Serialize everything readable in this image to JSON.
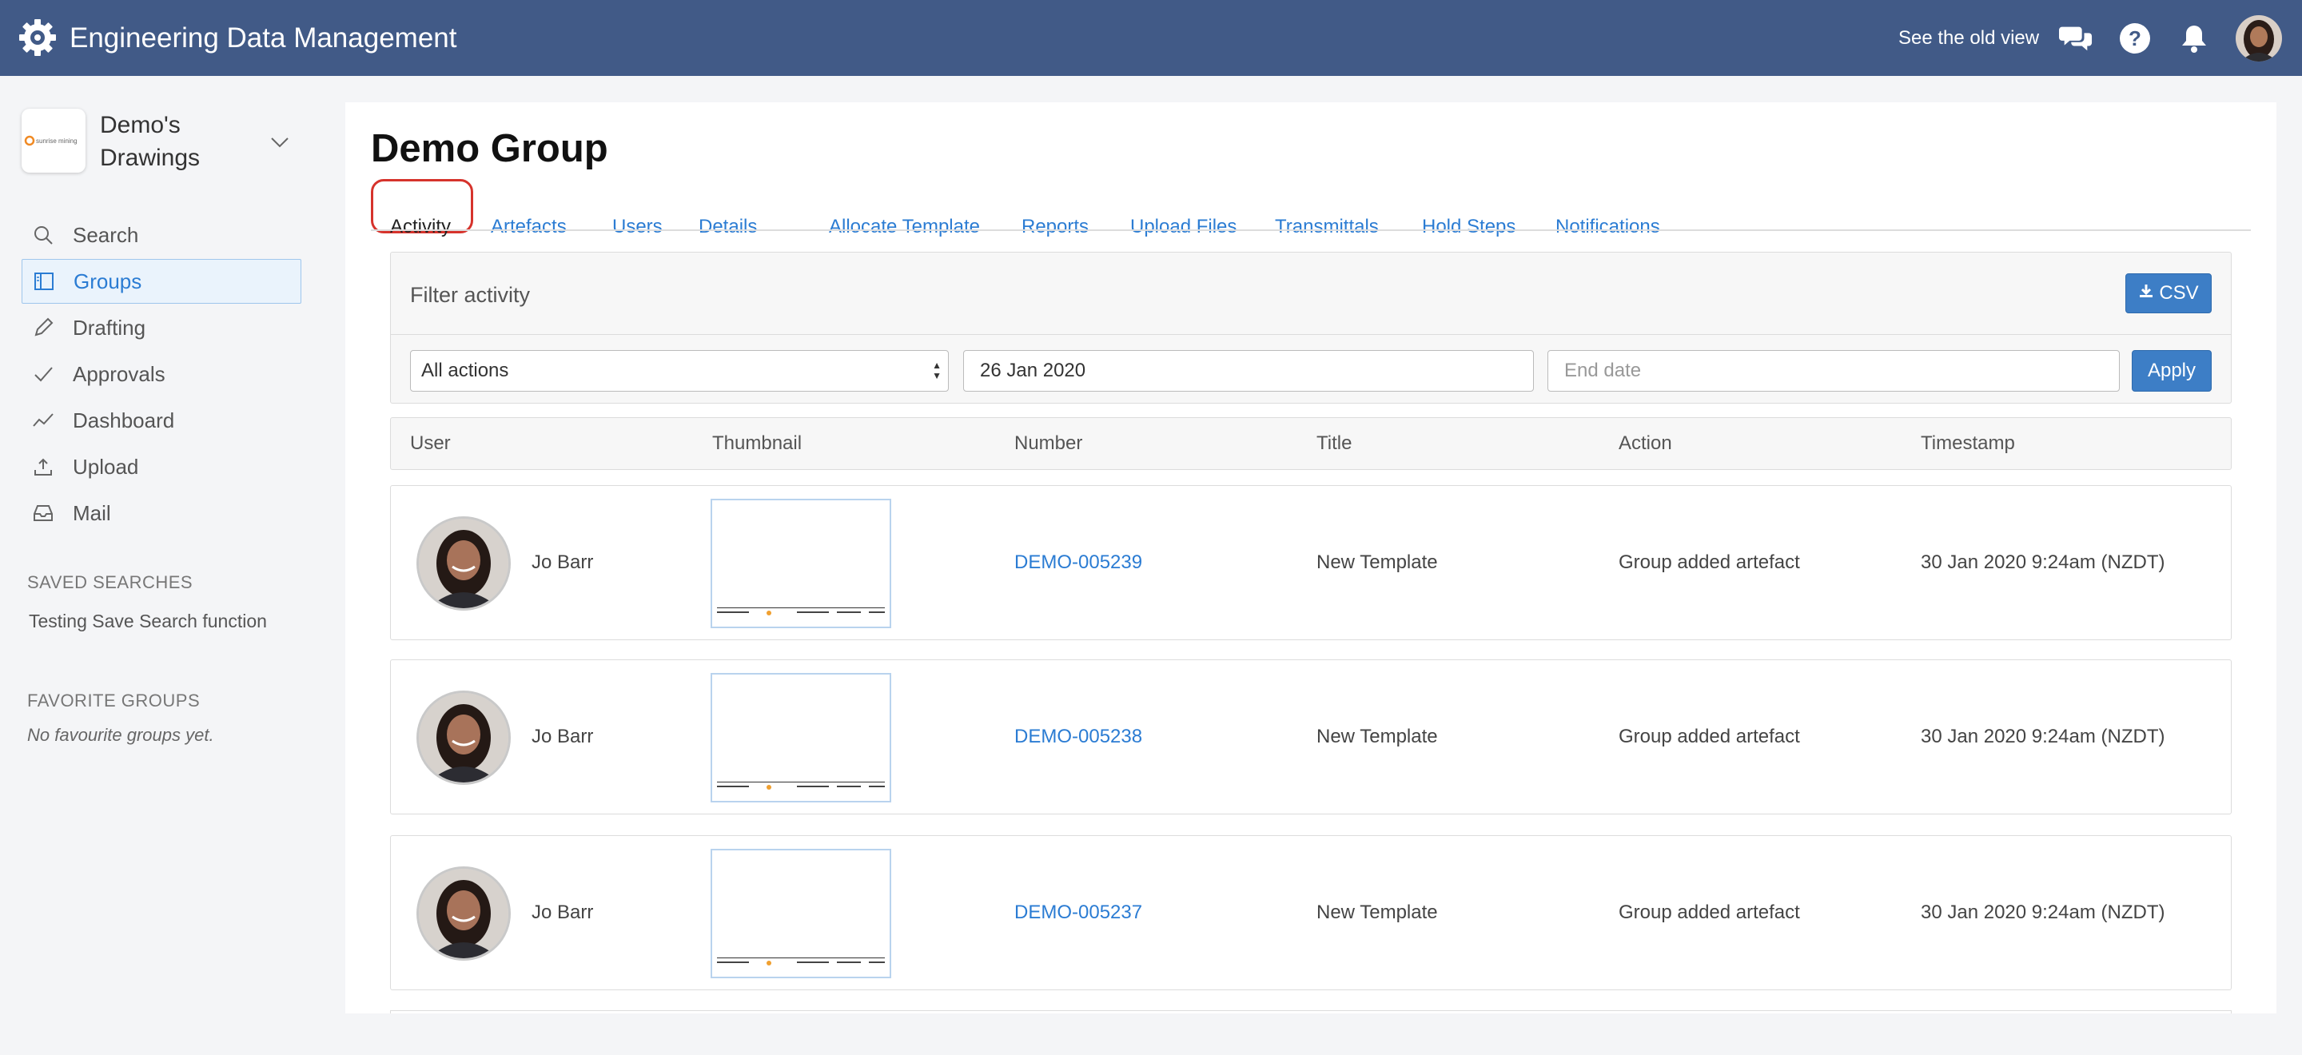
{
  "header": {
    "app_title": "Engineering Data Management",
    "old_view_link": "See the old view",
    "bg_color": "#415a87",
    "icons": [
      "gear-logo-icon",
      "chat-icon",
      "help-icon",
      "bell-icon"
    ]
  },
  "sidebar": {
    "org_name": "Demo's Drawings",
    "org_logo_text": "sunrise mining",
    "items": [
      {
        "label": "Search",
        "icon": "search-icon"
      },
      {
        "label": "Groups",
        "icon": "groups-icon",
        "active": true
      },
      {
        "label": "Drafting",
        "icon": "pencil-icon"
      },
      {
        "label": "Approvals",
        "icon": "check-icon"
      },
      {
        "label": "Dashboard",
        "icon": "chart-line-icon"
      },
      {
        "label": "Upload",
        "icon": "upload-icon"
      },
      {
        "label": "Mail",
        "icon": "inbox-icon"
      }
    ],
    "saved_searches_heading": "SAVED SEARCHES",
    "saved_searches": [
      "Testing Save Search function"
    ],
    "favorite_groups_heading": "FAVORITE GROUPS",
    "favorite_groups_empty": "No favourite groups yet."
  },
  "main": {
    "title": "Demo Group",
    "tabs": [
      {
        "label": "Activity",
        "active": true
      },
      {
        "label": "Artefacts"
      },
      {
        "label": "Users"
      },
      {
        "label": "Details"
      },
      {
        "label": "Allocate Template"
      },
      {
        "label": "Reports"
      },
      {
        "label": "Upload Files"
      },
      {
        "label": "Transmittals"
      },
      {
        "label": "Hold Steps"
      },
      {
        "label": "Notifications"
      }
    ],
    "accent_color": "#2b7cd3",
    "highlight_color": "#d6332c"
  },
  "filter": {
    "title": "Filter activity",
    "csv_label": "CSV",
    "action_select_value": "All actions",
    "start_date_value": "26 Jan 2020",
    "end_date_placeholder": "End date",
    "apply_label": "Apply"
  },
  "table": {
    "columns": [
      "User",
      "Thumbnail",
      "Number",
      "Title",
      "Action",
      "Timestamp"
    ],
    "rows": [
      {
        "user": "Jo Barr",
        "number": "DEMO-005239",
        "title": "New Template",
        "action": "Group added artefact",
        "timestamp": "30 Jan 2020 9:24am (NZDT)"
      },
      {
        "user": "Jo Barr",
        "number": "DEMO-005238",
        "title": "New Template",
        "action": "Group added artefact",
        "timestamp": "30 Jan 2020 9:24am (NZDT)"
      },
      {
        "user": "Jo Barr",
        "number": "DEMO-005237",
        "title": "New Template",
        "action": "Group added artefact",
        "timestamp": "30 Jan 2020 9:24am (NZDT)"
      }
    ]
  }
}
